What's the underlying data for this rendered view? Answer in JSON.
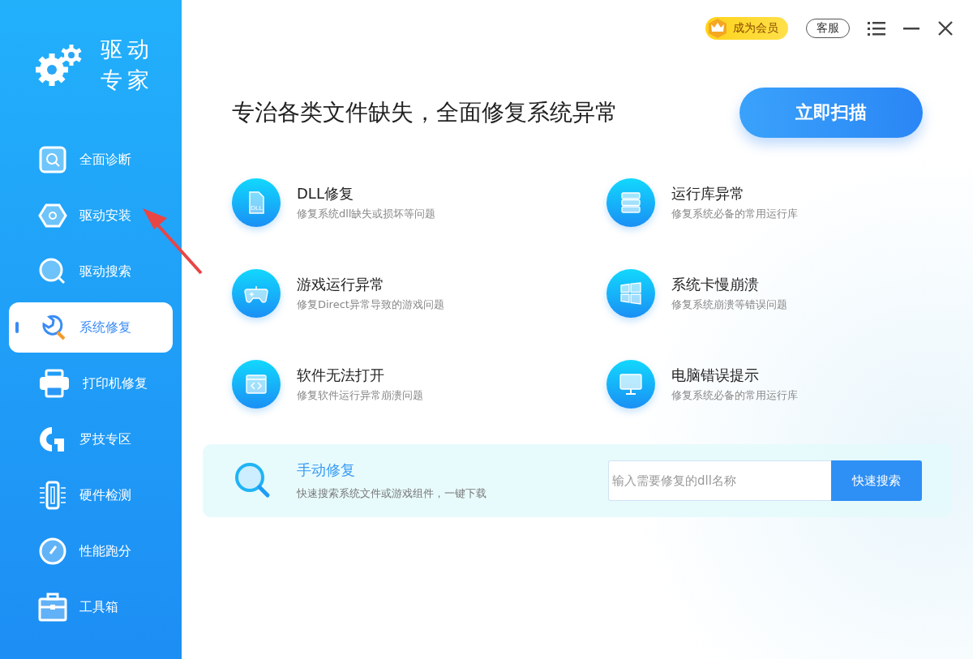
{
  "app": {
    "title_line_1": "驱动",
    "title_line_2": "专家"
  },
  "sidebar": {
    "items": [
      {
        "kind": "diagnose",
        "label": "全面诊断",
        "selected": false
      },
      {
        "kind": "install",
        "label": "驱动安装",
        "selected": false
      },
      {
        "kind": "search",
        "label": "驱动搜索",
        "selected": false
      },
      {
        "kind": "repair",
        "label": "系统修复",
        "selected": true
      },
      {
        "kind": "printer",
        "label": "打印机修复",
        "selected": false
      },
      {
        "kind": "logi",
        "label": "罗技专区",
        "selected": false
      },
      {
        "kind": "hardware",
        "label": "硬件检测",
        "selected": false
      },
      {
        "kind": "benchmark",
        "label": "性能跑分",
        "selected": false
      },
      {
        "kind": "toolbox",
        "label": "工具箱",
        "selected": false
      }
    ]
  },
  "top_bar": {
    "vip": "成为会员",
    "service": "客服"
  },
  "headline": "专治各类文件缺失，全面修复系统异常",
  "scan_button": "立即扫描",
  "features": [
    {
      "kind": "dll",
      "icon_label": "DLL",
      "title": "DLL修复",
      "description": "修复系统dll缺失或损坏等问题"
    },
    {
      "kind": "runtime",
      "title": "运行库异常",
      "description": "修复系统必备的常用运行库"
    },
    {
      "kind": "game",
      "title": "游戏运行异常",
      "description": "修复Direct异常导致的游戏问题"
    },
    {
      "kind": "windows",
      "title": "系统卡慢崩溃",
      "description": "修复系统崩溃等错误问题"
    },
    {
      "kind": "software",
      "title": "软件无法打开",
      "description": "修复软件运行异常崩溃问题"
    },
    {
      "kind": "monitor",
      "title": "电脑错误提示",
      "description": "修复系统必备的常用运行库"
    }
  ],
  "manual_repair": {
    "title": "手动修复",
    "description": "快速搜索系统文件或游戏组件，一键下载",
    "placeholder": "输入需要修复的dll名称",
    "button": "快速搜索"
  }
}
